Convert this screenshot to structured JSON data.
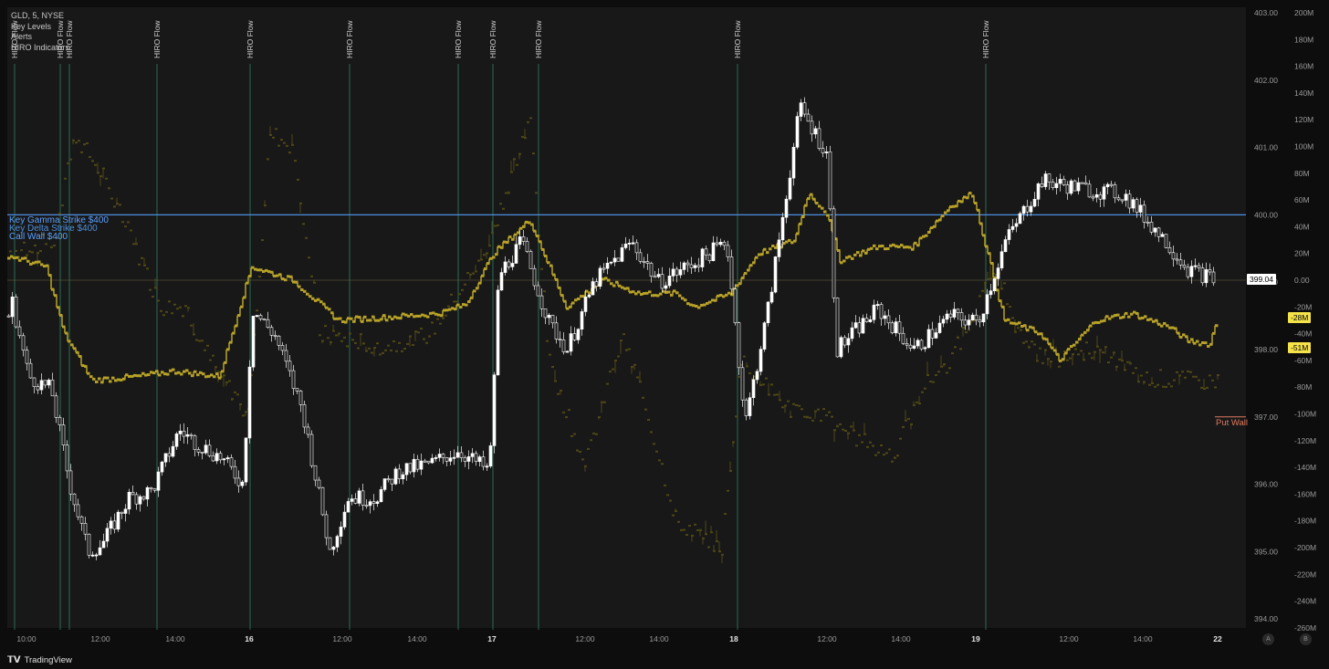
{
  "legend": {
    "symbol": "GLD, 5, NYSE",
    "items": [
      "Key Levels",
      "Alerts",
      "HIRO Indicators"
    ]
  },
  "key_levels": {
    "gamma": "Key Gamma Strike $400",
    "delta": "Key Delta Strike $400",
    "call_wall": "Call Wall $400",
    "put_wall": "Put Wall"
  },
  "price_tags": {
    "last": "399.04",
    "hiro_a": "-28M",
    "hiro_b": "-51M"
  },
  "footer": {
    "brand": "TradingView"
  },
  "axis_buttons": [
    "A",
    "B"
  ],
  "colors": {
    "price": "#ffffff",
    "hiro": "#b7a227",
    "hiro_faded": "#4e4716",
    "key_line": "#4d8fe0",
    "put_wall": "#e07a5f",
    "flow_marker": "#2e8a6b"
  },
  "chart_data": {
    "type": "candlestick",
    "price_axis": {
      "ticks": [
        "403.00",
        "402.00",
        "401.00",
        "400.00",
        "399.00",
        "398.00",
        "397.00",
        "396.00",
        "395.00",
        "394.00"
      ],
      "range": [
        393.9,
        403.05
      ]
    },
    "hiro_axis": {
      "ticks": [
        "200M",
        "180M",
        "160M",
        "140M",
        "120M",
        "100M",
        "80M",
        "60M",
        "40M",
        "20M",
        "0.00",
        "-20M",
        "-40M",
        "-60M",
        "-80M",
        "-100M",
        "-120M",
        "-140M",
        "-160M",
        "-180M",
        "-200M",
        "-220M",
        "-240M",
        "-260M"
      ]
    },
    "x_axis": {
      "ticks": [
        "10:00",
        "12:00",
        "14:00",
        "16",
        "12:00",
        "14:00",
        "17",
        "12:00",
        "14:00",
        "18",
        "12:00",
        "14:00",
        "19",
        "12:00",
        "14:00",
        "22"
      ]
    },
    "flow_marker_label": "HIRO Flow",
    "flow_marker_count": 11,
    "horizontal_levels": {
      "key_gamma_strike": 400.0,
      "call_wall": 400.0,
      "put_wall": 397.0,
      "last_price": 399.04
    },
    "price_path_anchors": [
      [
        0,
        398.1
      ],
      [
        12,
        398.7
      ],
      [
        30,
        397.6
      ],
      [
        55,
        397.4
      ],
      [
        75,
        396.0
      ],
      [
        95,
        395.0
      ],
      [
        110,
        395.1
      ],
      [
        140,
        395.8
      ],
      [
        165,
        395.9
      ],
      [
        195,
        396.8
      ],
      [
        215,
        396.6
      ],
      [
        240,
        396.4
      ],
      [
        265,
        396.0
      ],
      [
        275,
        398.6
      ],
      [
        300,
        398.2
      ],
      [
        330,
        397.1
      ],
      [
        360,
        395.0
      ],
      [
        380,
        395.8
      ],
      [
        410,
        395.8
      ],
      [
        435,
        396.2
      ],
      [
        470,
        396.3
      ],
      [
        500,
        396.5
      ],
      [
        535,
        396.2
      ],
      [
        545,
        399.1
      ],
      [
        570,
        399.6
      ],
      [
        600,
        398.4
      ],
      [
        620,
        398.0
      ],
      [
        650,
        399.0
      ],
      [
        690,
        399.6
      ],
      [
        720,
        399.0
      ],
      [
        760,
        399.3
      ],
      [
        795,
        399.6
      ],
      [
        815,
        396.9
      ],
      [
        840,
        398.6
      ],
      [
        875,
        401.6
      ],
      [
        905,
        400.9
      ],
      [
        915,
        398.0
      ],
      [
        960,
        398.6
      ],
      [
        1000,
        398.0
      ],
      [
        1040,
        398.5
      ],
      [
        1070,
        398.4
      ],
      [
        1100,
        399.6
      ],
      [
        1140,
        400.5
      ],
      [
        1180,
        400.4
      ],
      [
        1230,
        400.3
      ],
      [
        1270,
        399.7
      ],
      [
        1300,
        399.2
      ],
      [
        1330,
        399.04
      ]
    ],
    "hiro_path_anchors": [
      [
        0,
        20
      ],
      [
        50,
        10
      ],
      [
        70,
        -40
      ],
      [
        100,
        -75
      ],
      [
        150,
        -72
      ],
      [
        190,
        -68
      ],
      [
        240,
        -72
      ],
      [
        275,
        10
      ],
      [
        320,
        0
      ],
      [
        370,
        -30
      ],
      [
        420,
        -28
      ],
      [
        480,
        -25
      ],
      [
        510,
        -18
      ],
      [
        540,
        20
      ],
      [
        580,
        45
      ],
      [
        620,
        -20
      ],
      [
        660,
        0
      ],
      [
        700,
        -10
      ],
      [
        740,
        -10
      ],
      [
        760,
        -20
      ],
      [
        800,
        -10
      ],
      [
        830,
        20
      ],
      [
        870,
        30
      ],
      [
        885,
        65
      ],
      [
        905,
        50
      ],
      [
        920,
        15
      ],
      [
        960,
        25
      ],
      [
        1000,
        25
      ],
      [
        1040,
        55
      ],
      [
        1065,
        65
      ],
      [
        1100,
        -30
      ],
      [
        1140,
        -40
      ],
      [
        1160,
        -60
      ],
      [
        1200,
        -30
      ],
      [
        1240,
        -25
      ],
      [
        1280,
        -35
      ],
      [
        1300,
        -45
      ],
      [
        1325,
        -48
      ],
      [
        1333,
        -28
      ]
    ],
    "hiro_faded_path_anchors": [
      [
        0,
        20
      ],
      [
        60,
        30
      ],
      [
        80,
        110
      ],
      [
        110,
        80
      ],
      [
        150,
        20
      ],
      [
        175,
        -20
      ],
      [
        200,
        -20
      ],
      [
        230,
        -60
      ],
      [
        270,
        -100
      ],
      [
        295,
        110
      ],
      [
        320,
        100
      ],
      [
        350,
        -40
      ],
      [
        420,
        -50
      ],
      [
        470,
        -40
      ],
      [
        530,
        20
      ],
      [
        580,
        120
      ],
      [
        600,
        -60
      ],
      [
        640,
        -140
      ],
      [
        680,
        -40
      ],
      [
        700,
        -80
      ],
      [
        740,
        -180
      ],
      [
        790,
        -200
      ],
      [
        810,
        -60
      ],
      [
        870,
        -100
      ],
      [
        900,
        -100
      ],
      [
        940,
        -120
      ],
      [
        980,
        -130
      ],
      [
        1010,
        -80
      ],
      [
        1040,
        -60
      ],
      [
        1070,
        -20
      ],
      [
        1090,
        10
      ],
      [
        1120,
        -50
      ],
      [
        1160,
        -60
      ],
      [
        1200,
        -50
      ],
      [
        1240,
        -70
      ],
      [
        1280,
        -75
      ],
      [
        1333,
        -75
      ]
    ]
  }
}
